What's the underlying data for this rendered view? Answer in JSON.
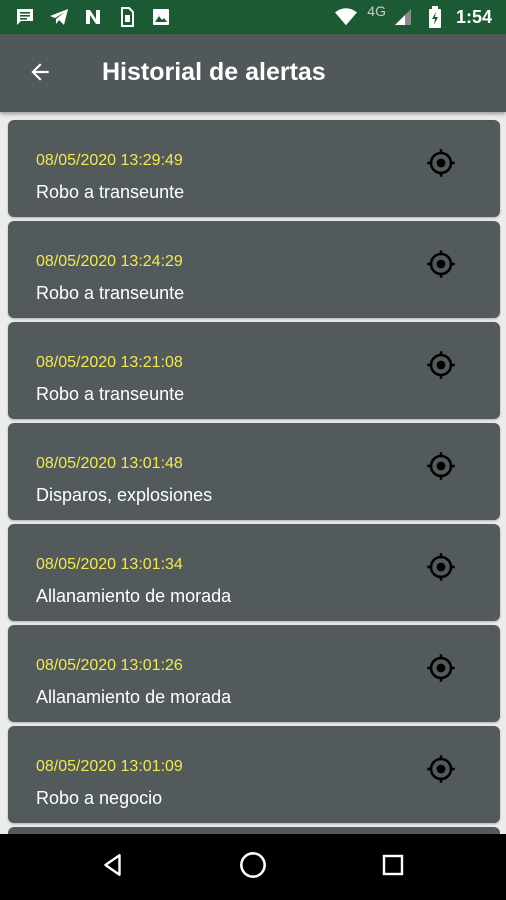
{
  "status_bar": {
    "network": "4G",
    "time": "1:54",
    "icons": [
      "message-icon",
      "telegram-icon",
      "n-app-icon",
      "sim-card-icon",
      "image-icon",
      "wifi-icon",
      "signal-icon",
      "battery-icon"
    ]
  },
  "app_bar": {
    "title": "Historial de alertas",
    "back_icon": "arrow-back-icon"
  },
  "alerts": [
    {
      "datetime": "08/05/2020 13:29:49",
      "type": "Robo a transeunte"
    },
    {
      "datetime": "08/05/2020 13:24:29",
      "type": "Robo a transeunte"
    },
    {
      "datetime": "08/05/2020 13:21:08",
      "type": "Robo a transeunte"
    },
    {
      "datetime": "08/05/2020 13:01:48",
      "type": "Disparos, explosiones"
    },
    {
      "datetime": "08/05/2020 13:01:34",
      "type": "Allanamiento de morada"
    },
    {
      "datetime": "08/05/2020 13:01:26",
      "type": "Allanamiento de morada"
    },
    {
      "datetime": "08/05/2020 13:01:09",
      "type": "Robo a negocio"
    }
  ],
  "nav_bar": {
    "icons": [
      "back-triangle-icon",
      "home-circle-icon",
      "recents-square-icon"
    ]
  },
  "colors": {
    "status_bar": "#1c5a33",
    "app_bar": "#51585a",
    "card": "#535a5c",
    "date_text": "#f2e94e",
    "background": "#ececec"
  }
}
